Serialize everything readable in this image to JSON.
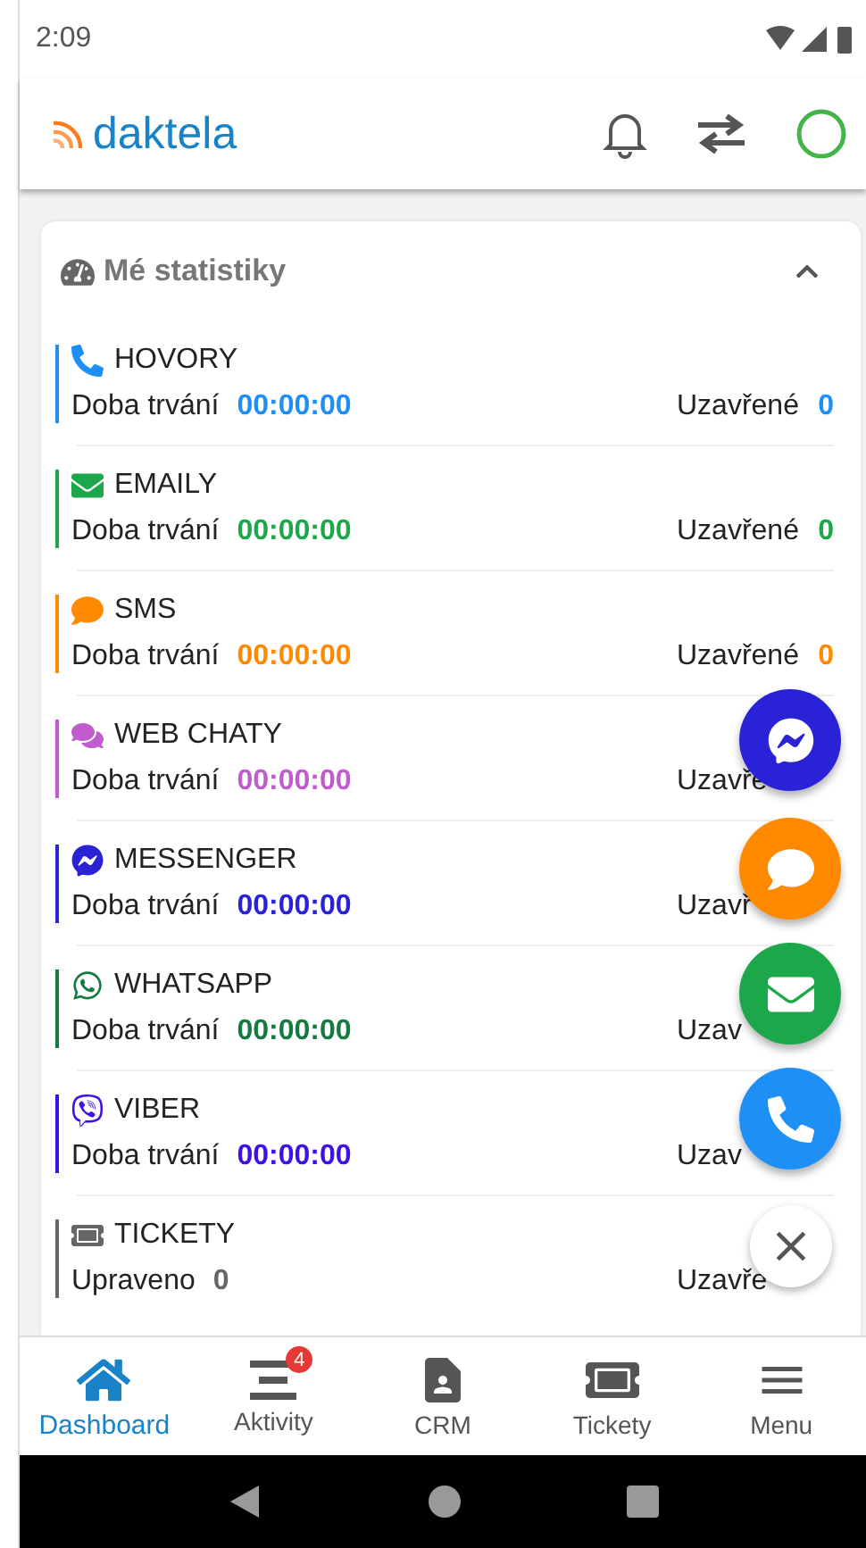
{
  "status_bar": {
    "time": "2:09"
  },
  "header": {
    "logo": "daktela",
    "online": true
  },
  "stats": {
    "title": "Mé statistiky",
    "expanded": true,
    "rows": [
      {
        "kind": "phone",
        "title": "HOVORY",
        "color": "#1e8ff5",
        "left_label": "Doba trvání",
        "left_value": "00:00:00",
        "right_label": "Uzavřené",
        "right_value": "0"
      },
      {
        "kind": "envelope",
        "title": "EMAILY",
        "color": "#1ca84a",
        "left_label": "Doba trvání",
        "left_value": "00:00:00",
        "right_label": "Uzavřené",
        "right_value": "0"
      },
      {
        "kind": "sms",
        "title": "SMS",
        "color": "#ff8a00",
        "left_label": "Doba trvání",
        "left_value": "00:00:00",
        "right_label": "Uzavřené",
        "right_value": "0"
      },
      {
        "kind": "chats",
        "title": "WEB CHATY",
        "color": "#c15cce",
        "left_label": "Doba trvání",
        "left_value": "00:00:00",
        "right_label": "Uzavře"
      },
      {
        "kind": "messenger",
        "title": "MESSENGER",
        "color": "#2a22d6",
        "left_label": "Doba trvání",
        "left_value": "00:00:00",
        "right_label": "Uzavř"
      },
      {
        "kind": "whatsapp",
        "title": "WHATSAPP",
        "color": "#147a40",
        "left_label": "Doba trvání",
        "left_value": "00:00:00",
        "right_label": "Uzav"
      },
      {
        "kind": "viber",
        "title": "VIBER",
        "color": "#4011e6",
        "left_label": "Doba trvání",
        "left_value": "00:00:00",
        "right_label": "Uzav"
      },
      {
        "kind": "ticket",
        "title": "TICKETY",
        "color": "#666666",
        "left_label": "Upraveno",
        "left_value": "0",
        "right_label": "Uzavře"
      }
    ]
  },
  "fabs": [
    {
      "kind": "messenger",
      "color": "#2a22d6"
    },
    {
      "kind": "sms",
      "color": "#ff8a00"
    },
    {
      "kind": "envelope",
      "color": "#1ca84a"
    },
    {
      "kind": "phone",
      "color": "#1e8ff5"
    }
  ],
  "bottom_nav": [
    {
      "kind": "home",
      "label": "Dashboard",
      "selected": true
    },
    {
      "kind": "list",
      "label": "Aktivity",
      "selected": false,
      "badge": "4"
    },
    {
      "kind": "contact",
      "label": "CRM",
      "selected": false
    },
    {
      "kind": "ticket",
      "label": "Tickety",
      "selected": false
    },
    {
      "kind": "menu",
      "label": "Menu",
      "selected": false
    }
  ]
}
